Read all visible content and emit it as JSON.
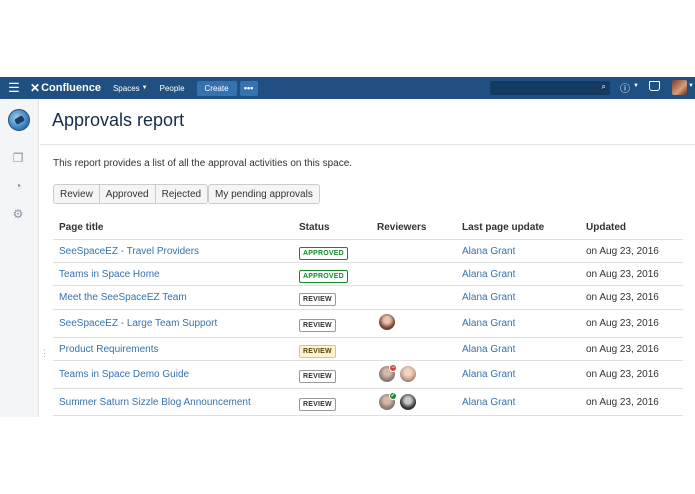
{
  "nav": {
    "logo": "Confluence",
    "spaces": "Spaces",
    "people": "People",
    "create": "Create",
    "more": "•••"
  },
  "page": {
    "title": "Approvals report",
    "description": "This report provides a list of all the approval activities on this space."
  },
  "filters": {
    "review": "Review",
    "approved": "Approved",
    "rejected": "Rejected",
    "pending": "My pending approvals"
  },
  "table": {
    "headers": [
      "Page title",
      "Status",
      "Reviewers",
      "Last page update",
      "Updated"
    ],
    "rows": [
      {
        "title": "SeeSpaceEZ - Travel Providers",
        "status": "APPROVED",
        "updater": "Alana Grant",
        "updated": "on Aug 23, 2016"
      },
      {
        "title": "Teams in Space Home",
        "status": "APPROVED",
        "updater": "Alana Grant",
        "updated": "on Aug 23, 2016"
      },
      {
        "title": "Meet the SeeSpaceEZ Team",
        "status": "REVIEW",
        "updater": "Alana Grant",
        "updated": "on Aug 23, 2016"
      },
      {
        "title": "SeeSpaceEZ - Large Team Support",
        "status": "REVIEW",
        "updater": "Alana Grant",
        "updated": "on Aug 23, 2016"
      },
      {
        "title": "Product Requirements",
        "status": "REVIEW",
        "updater": "Alana Grant",
        "updated": "on Aug 23, 2016"
      },
      {
        "title": "Teams in Space Demo Guide",
        "status": "REVIEW",
        "updater": "Alana Grant",
        "updated": "on Aug 23, 2016"
      },
      {
        "title": "Summer Saturn Sizzle Blog Announcement",
        "status": "REVIEW",
        "updater": "Alana Grant",
        "updated": "on Aug 23, 2016"
      }
    ]
  },
  "colors": {
    "nav_bg": "#205081",
    "link": "#3572b0",
    "approved": "#14892c",
    "rejected": "#d04437"
  }
}
